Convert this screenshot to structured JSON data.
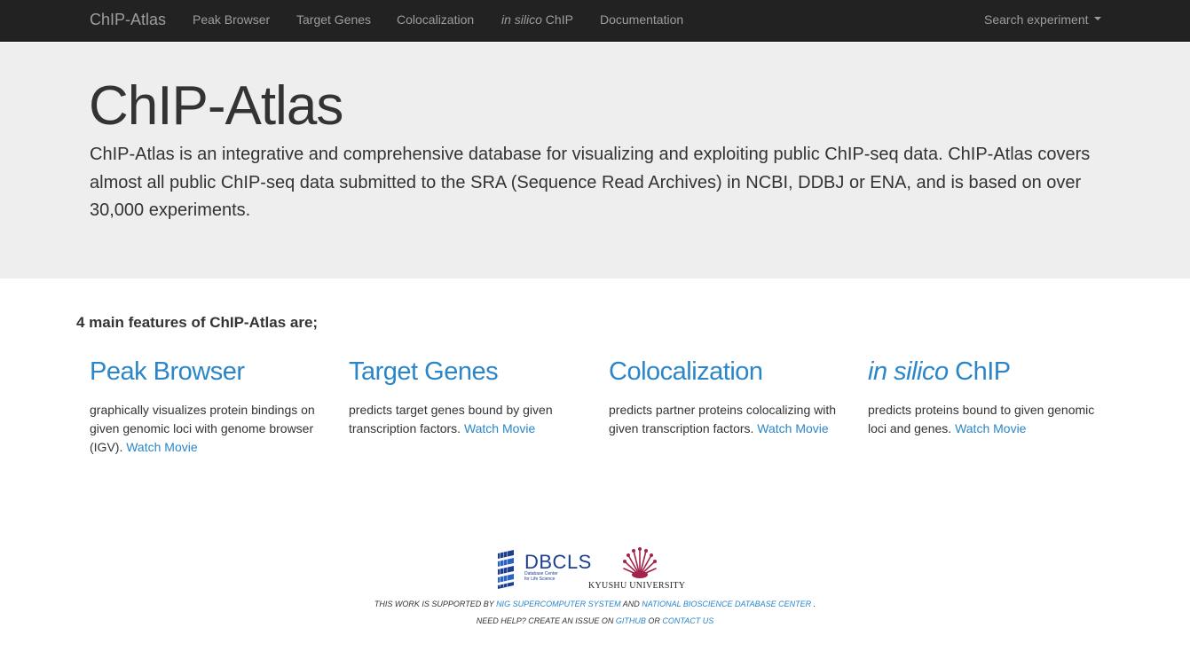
{
  "navbar": {
    "brand": "ChIP-Atlas",
    "items": [
      {
        "label": "Peak Browser"
      },
      {
        "label": "Target Genes"
      },
      {
        "label": "Colocalization"
      },
      {
        "label_italic": "in silico",
        "label_rest": " ChIP"
      },
      {
        "label": "Documentation"
      }
    ],
    "search_dropdown": "Search experiment"
  },
  "jumbotron": {
    "title": "ChIP-Atlas",
    "description": "ChIP-Atlas is an integrative and comprehensive database for visualizing and exploiting public ChIP-seq data. ChIP-Atlas covers almost all public ChIP-seq data submitted to the SRA (Sequence Read Archives) in NCBI, DDBJ or ENA, and is based on over 30,000 experiments."
  },
  "features": {
    "heading": "4 main features of ChIP-Atlas are;",
    "items": [
      {
        "title": "Peak Browser",
        "desc": "graphically visualizes protein bindings on given genomic loci with genome browser (IGV). ",
        "link": "Watch Movie"
      },
      {
        "title": "Target Genes",
        "desc": "predicts target genes bound by given transcription factors. ",
        "link": "Watch Movie"
      },
      {
        "title": "Colocalization",
        "desc": "predicts partner proteins colocalizing with given transcription factors. ",
        "link": "Watch Movie"
      },
      {
        "title_italic": "in silico",
        "title_rest": " ChIP",
        "desc": "predicts proteins bound to given genomic loci and genes. ",
        "link": "Watch Movie"
      }
    ]
  },
  "footer": {
    "dbcls_logo_text": "DBCLS",
    "dbcls_logo_sub_1": "Database Center",
    "dbcls_logo_sub_2": "for Life Science",
    "kyushu_logo_text": "KYUSHU UNIVERSITY",
    "support_prefix": "This work is supported by ",
    "support_link_1": "NIG supercomputer system",
    "support_and": " and ",
    "support_link_2": "National Bioscience Database Center",
    "support_suffix": " .",
    "help_prefix": "Need help? Create an issue on ",
    "help_link_1": "GitHub",
    "help_or": " or ",
    "help_link_2": "contact us"
  },
  "colors": {
    "navbar_bg": "#222222",
    "jumbotron_bg": "#eeeeee",
    "link": "#2a86c9",
    "dbcls_blue": "#1d3f91",
    "kyushu_red": "#a3234a"
  },
  "icons": [
    "caret-down-icon",
    "dbcls-logo-icon",
    "kyushu-logo-icon"
  ]
}
